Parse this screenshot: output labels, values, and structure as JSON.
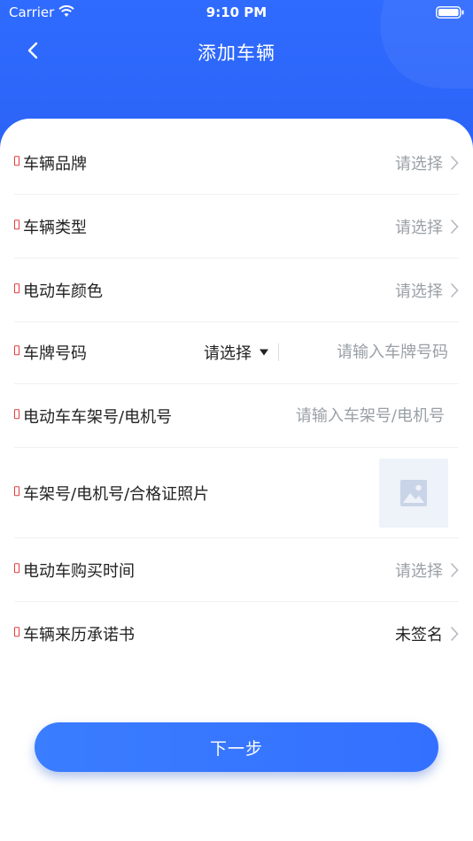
{
  "status_bar": {
    "carrier": "Carrier",
    "time": "9:10 PM"
  },
  "nav": {
    "title": "添加车辆",
    "back_icon": "chevron-left-icon"
  },
  "form": {
    "brand": {
      "label": "车辆品牌",
      "value": "请选择"
    },
    "type": {
      "label": "车辆类型",
      "value": "请选择"
    },
    "color": {
      "label": "电动车颜色",
      "value": "请选择"
    },
    "plate": {
      "label": "车牌号码",
      "select_value": "请选择",
      "placeholder": "请输入车牌号码"
    },
    "frame_number": {
      "label": "电动车车架号/电机号",
      "placeholder": "请输入车架号/电机号"
    },
    "photo": {
      "label": "车架号/电机号/合格证照片",
      "icon": "image-icon"
    },
    "purchase_time": {
      "label": "电动车购买时间",
      "value": "请选择"
    },
    "commitment": {
      "label": "车辆来历承诺书",
      "value": "未签名"
    }
  },
  "next_button": {
    "label": "下一步"
  },
  "colors": {
    "primary": "#2f6bff",
    "required_mark": "#e33b3b",
    "placeholder": "#9aa0a6"
  }
}
